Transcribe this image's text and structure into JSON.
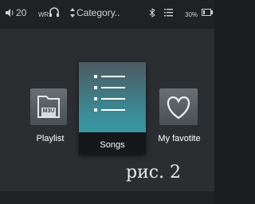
{
  "status_bar": {
    "volume_icon": "speaker-icon",
    "volume_level": "20",
    "headphone_text": "WR",
    "headphone_icon": "headphones-icon",
    "sort_icon": "sort-arrows-icon",
    "category_label": "Category..",
    "bluetooth_icon": "bluetooth-icon",
    "list_icon": "list-icon",
    "battery_percent": "30%",
    "battery_icon": "battery-icon",
    "battery_level": 0.3
  },
  "menu": {
    "items": [
      {
        "label": "Playlist",
        "icon": "m3u-folder-icon",
        "sublabel": "M3U",
        "selected": false
      },
      {
        "label": "Songs",
        "icon": "song-list-icon",
        "selected": true
      },
      {
        "label": "My favotite",
        "icon": "heart-icon",
        "selected": false
      }
    ]
  },
  "caption": "рис. 2",
  "colors": {
    "background": "#2b2e31",
    "status_bar": "#1f2123",
    "accent": "#35a8b4"
  }
}
